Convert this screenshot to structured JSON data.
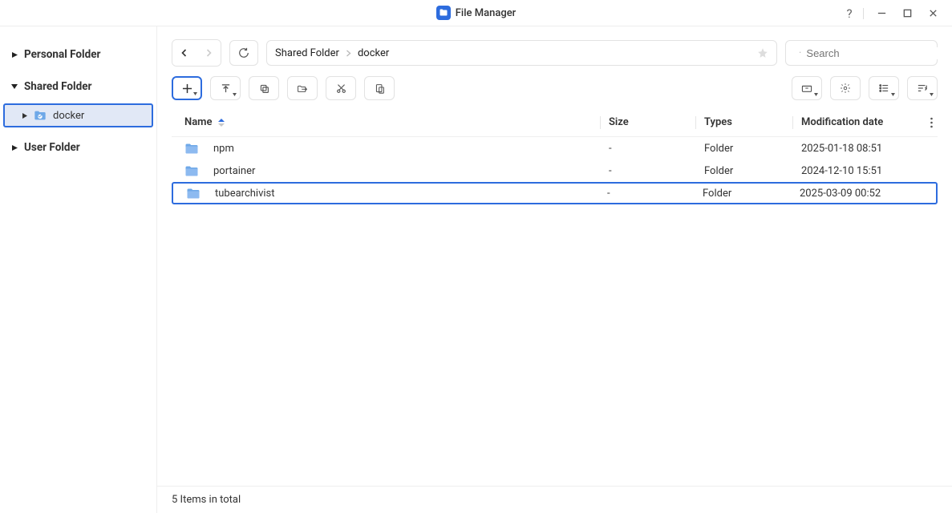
{
  "titlebar": {
    "title": "File Manager"
  },
  "sidebar": {
    "roots": [
      {
        "label": "Personal Folder",
        "expanded": false
      },
      {
        "label": "Shared Folder",
        "expanded": true,
        "children": [
          {
            "label": "docker",
            "active": true
          }
        ]
      },
      {
        "label": "User Folder",
        "expanded": false
      }
    ]
  },
  "breadcrumb": {
    "root": "Shared Folder",
    "current": "docker"
  },
  "search": {
    "placeholder": "Search"
  },
  "columns": {
    "name": "Name",
    "size": "Size",
    "types": "Types",
    "mod": "Modification date"
  },
  "rows": [
    {
      "name": "npm",
      "size": "-",
      "type": "Folder",
      "mod": "2025-01-18 08:51",
      "hl": false
    },
    {
      "name": "portainer",
      "size": "-",
      "type": "Folder",
      "mod": "2024-12-10 15:51",
      "hl": false
    },
    {
      "name": "tubearchivist",
      "size": "-",
      "type": "Folder",
      "mod": "2025-03-09 00:52",
      "hl": true
    }
  ],
  "status": {
    "text": "5 Items in total"
  }
}
